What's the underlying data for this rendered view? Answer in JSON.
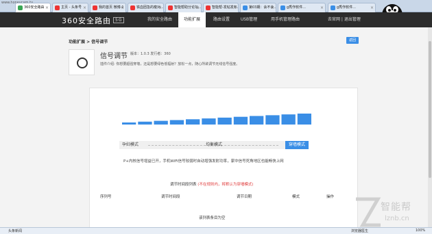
{
  "browser": {
    "url": "www.honeycam.tv",
    "tabs": [
      {
        "label": "360安全路由",
        "color": "#3aa655",
        "active": true
      },
      {
        "label": "主页 - 头条号",
        "color": "#e33",
        "active": false
      },
      {
        "label": "我的首页 微博-1",
        "color": "#e33",
        "active": false
      },
      {
        "label": "铁血团急的瘦对...",
        "color": "#e33",
        "active": false
      },
      {
        "label": "智能帮助分论坛...",
        "color": "#e33",
        "active": false
      },
      {
        "label": "智能帮-发帖发布...",
        "color": "#e33",
        "active": false
      },
      {
        "label": "第03期：会不会...",
        "color": "#3a8ee6",
        "active": false
      },
      {
        "label": "g秀作软件...",
        "color": "#3a8ee6",
        "active": false
      },
      {
        "label": "g秀作软件...",
        "color": "#3a8ee6",
        "active": false
      }
    ]
  },
  "router": {
    "logo": "360安全路由",
    "version": "5G",
    "nav": [
      "我的安全路由",
      "功能扩展",
      "路由设置",
      "USB管理",
      "用手机管理路由"
    ],
    "active_nav": "功能扩展",
    "right_links": "去官网 | 退出管理"
  },
  "page": {
    "breadcrumb": "功能扩展 > 信号调节",
    "back_label": "返回",
    "app_title": "信号调节",
    "app_meta": "版本：1.0.3    发行者：360",
    "app_desc": "插件介绍: 你想要超强穿墙，还是想要绿色低辐射？放松一点，随心所欲调节无线信号强度。",
    "modes": [
      "孕妇模式",
      "均衡模式",
      "穿墙模式"
    ],
    "active_mode": "穿墙模式",
    "mode_desc": "P+内核信号增益已开，手机WiFi信号较弱时自动增强发射功率，家中信号死角地区也能畅快上网",
    "list_title": "调节时间段列表",
    "list_note": "(不在规则内，将默认为穿墙模式)",
    "columns": [
      "序列号",
      "调节时间段",
      "调节日期",
      "模式",
      "操作"
    ],
    "empty_text": "该列表条目为空",
    "signal_level": 1.0
  },
  "watermark": {
    "text_cn": "智能帮",
    "text_en": "lznb.cn"
  },
  "status": {
    "left": "头条新闻",
    "right_items": [
      "浏览器医生",
      "100%"
    ]
  }
}
